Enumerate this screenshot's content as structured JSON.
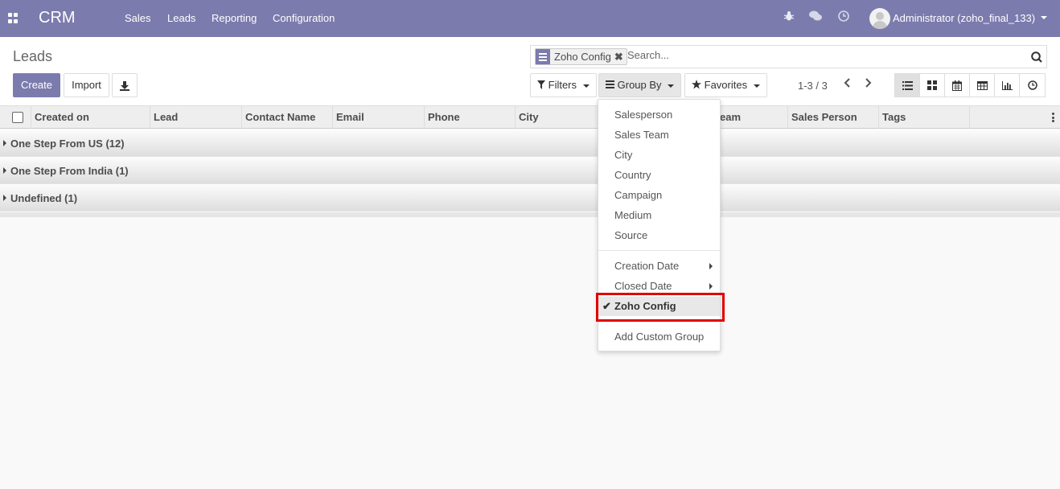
{
  "navbar": {
    "brand": "CRM",
    "menu": [
      "Sales",
      "Leads",
      "Reporting",
      "Configuration"
    ],
    "user": "Administrator (zoho_final_133)",
    "icons": [
      "apps-icon",
      "bug-icon",
      "chat-icon",
      "clock-icon",
      "avatar",
      "chevron-down-icon"
    ],
    "color": "#7c7bad"
  },
  "control_panel": {
    "breadcrumb": "Leads",
    "create_label": "Create",
    "import_label": "Import",
    "download_icon": "download-icon"
  },
  "search": {
    "facet_label": "Zoho Config",
    "facet_icon": "group-by-icon",
    "placeholder": "Search..."
  },
  "filters": {
    "filters_label": "Filters",
    "group_by_label": "Group By",
    "favorites_label": "Favorites"
  },
  "pager": {
    "label": "1-3 / 3"
  },
  "views": [
    "list-view",
    "kanban-view",
    "calendar-view",
    "pivot-view",
    "graph-view",
    "activity-view"
  ],
  "table": {
    "columns": [
      "Created on",
      "Lead",
      "Contact Name",
      "Email",
      "Phone",
      "City",
      "es Team",
      "Sales Person",
      "Tags"
    ],
    "groups": [
      "One Step From US (12)",
      "One Step From India (1)",
      "Undefined (1)"
    ]
  },
  "group_by_menu": {
    "fields": [
      "Salesperson",
      "Sales Team",
      "City",
      "Country",
      "Campaign",
      "Medium",
      "Source"
    ],
    "date_fields": [
      "Creation Date",
      "Closed Date"
    ],
    "selected": "Zoho Config",
    "add_custom": "Add Custom Group"
  },
  "colors": {
    "brand": "#7c7bad",
    "highlight": "#e00000"
  }
}
